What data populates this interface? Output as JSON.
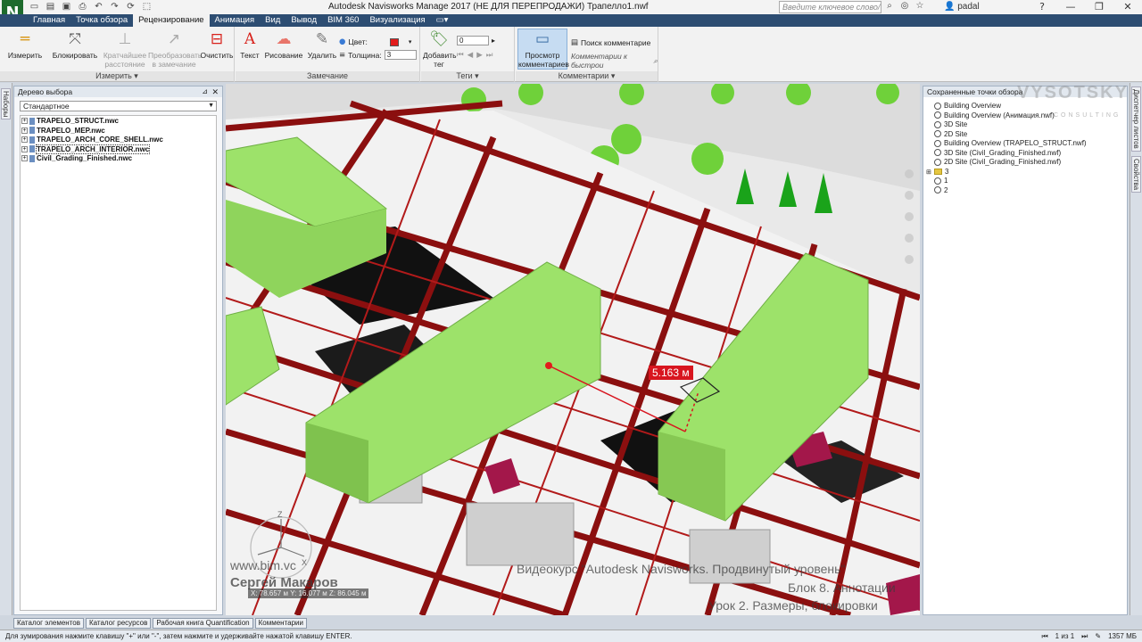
{
  "app": {
    "logo_letter": "N",
    "title": "Autodesk Navisworks Manage 2017 (НЕ ДЛЯ ПЕРЕПРОДАЖИ)    Трапелло1.nwf",
    "search_placeholder": "Введите ключевое слово/фразу",
    "user": "padal"
  },
  "tabs": [
    "Главная",
    "Точка обзора",
    "Рецензирование",
    "Анимация",
    "Вид",
    "Вывод",
    "BIM 360",
    "Визуализация"
  ],
  "active_tab": "Рецензирование",
  "ribbon": {
    "measure_group": {
      "label": "Измерить",
      "buttons": [
        "Измерить",
        "Блокировать",
        "Кратчайшее расстояние",
        "Преобразовать в замечание",
        "Очистить"
      ]
    },
    "redline_group": {
      "label": "Замечание",
      "buttons": [
        "Текст",
        "Рисование",
        "Удалить"
      ],
      "color_label": "Цвет:",
      "thickness_label": "Толщина:",
      "thickness_value": "3",
      "color_value": "#e21c1c"
    },
    "tags_group": {
      "label": "Теги",
      "add_tag": "Добавить тег",
      "tag_id_value": "0"
    },
    "comments_group": {
      "label": "Комментарии",
      "view_comments": "Просмотр комментариев",
      "find_comments": "Поиск комментарие",
      "quick_find_placeholder": "Комментарии к быстрои"
    }
  },
  "left_panel": {
    "title": "Дерево выбора",
    "combo_value": "Стандартное",
    "items": [
      "TRAPELO_STRUCT.nwc",
      "TRAPELO_MEP.nwc",
      "TRAPELO_ARCH_CORE_SHELL.nwc",
      "TRAPELO_ARCH_INTERIOR.nwc",
      "Civil_Grading_Finished.nwc"
    ],
    "selected_index": 3
  },
  "right_panel": {
    "title": "Сохраненные точки обзора",
    "items": [
      {
        "label": "Building Overview",
        "type": "view"
      },
      {
        "label": "Building Overview (Анимация.nwf)",
        "type": "view"
      },
      {
        "label": "3D Site",
        "type": "view"
      },
      {
        "label": "2D Site",
        "type": "view"
      },
      {
        "label": "Building Overview (TRAPELO_STRUCT.nwf)",
        "type": "view"
      },
      {
        "label": "3D Site (Civil_Grading_Finished.nwf)",
        "type": "view"
      },
      {
        "label": "2D Site (Civil_Grading_Finished.nwf)",
        "type": "view"
      },
      {
        "label": "3",
        "type": "folder"
      },
      {
        "label": "1",
        "type": "view"
      },
      {
        "label": "2",
        "type": "view"
      }
    ]
  },
  "left_strip_tabs": [
    "Наборы"
  ],
  "right_strip_tabs": [
    "Диспетчер листов",
    "Свойства"
  ],
  "viewport": {
    "measure_value": "5.163 м",
    "coords_text": "X: 78.657 м  Y: 16.077 м  Z: 86.045 м",
    "overlay_site": "www.bim.vc",
    "overlay_author": "Сергей Макаров",
    "overlay_course": "Видеокурс \"Autodesk Navisworks. Продвинутый уровень\"",
    "overlay_block": "Блок 8. Аннотации",
    "overlay_lesson": "Урок 2. Размеры, блокировки",
    "watermark": "VYSOTSKY",
    "watermark_sub": "CONSULTING",
    "colors": {
      "structure": "#8b0f0f",
      "green_mass": "#9de26a",
      "red_marker": "#e21c1c"
    }
  },
  "bottom_tabs": [
    "Каталог элементов",
    "Каталог ресурсов",
    "Рабочая книга Quantification",
    "Комментарии"
  ],
  "status": {
    "hint": "Для зумирования нажмите клавишу \"+\" или \"-\", затем нажмите и удерживайте нажатой клавишу ENTER.",
    "page": "1 из 1",
    "memory": "1357 МБ"
  }
}
